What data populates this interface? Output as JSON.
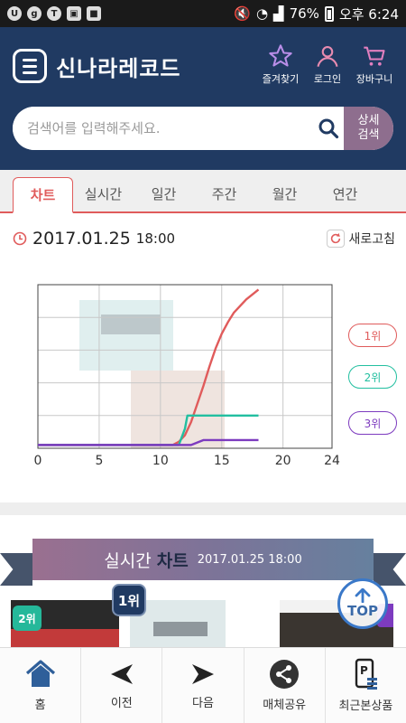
{
  "status_bar": {
    "battery": "76%",
    "time": "오후 6:24",
    "left_icons": [
      "circle-u-icon",
      "circle-g-icon",
      "talk-icon",
      "image-icon",
      "app-icon"
    ]
  },
  "header": {
    "logo_text": "신나라레코드",
    "favorites_label": "즐겨찾기",
    "login_label": "로그인",
    "cart_label": "장바구니"
  },
  "search": {
    "placeholder": "검색어를 입력해주세요.",
    "advanced_label_1": "상세",
    "advanced_label_2": "검색"
  },
  "tabs": [
    "차트",
    "실시간",
    "일간",
    "주간",
    "월간",
    "연간"
  ],
  "active_tab": 0,
  "chart_header": {
    "date": "2017.01.25",
    "time": "18:00",
    "refresh_label": "새로고침"
  },
  "chart_data": {
    "type": "line",
    "xlim": [
      0,
      24
    ],
    "x_ticks": [
      "0",
      "5",
      "10",
      "15",
      "20",
      "24"
    ],
    "series": [
      {
        "name": "1위",
        "color": "#e05b5b",
        "x": [
          0,
          11,
          11.5,
          12,
          12.5,
          13,
          13.5,
          14,
          14.5,
          15,
          15.5,
          16,
          17,
          18
        ],
        "y": [
          0.02,
          0.02,
          0.04,
          0.08,
          0.16,
          0.27,
          0.38,
          0.5,
          0.61,
          0.7,
          0.77,
          0.83,
          0.91,
          0.97
        ]
      },
      {
        "name": "2위",
        "color": "#22bfa0",
        "x": [
          0,
          11.5,
          12,
          12.2,
          18
        ],
        "y": [
          0.02,
          0.02,
          0.12,
          0.2,
          0.2
        ]
      },
      {
        "name": "3위",
        "color": "#7d3bbf",
        "x": [
          0,
          12.5,
          13.5,
          18
        ],
        "y": [
          0.02,
          0.02,
          0.05,
          0.05
        ]
      }
    ],
    "grid": true,
    "legend_position": "right"
  },
  "realtime_banner": {
    "label": "실시간",
    "label_bold": "차트",
    "datetime": "2017.01.25 18:00"
  },
  "cards": [
    {
      "rank_label": "2위"
    },
    {
      "rank_label": "1위"
    }
  ],
  "top_button": "TOP",
  "bottom_nav": [
    {
      "label": "홈",
      "icon": "home-icon"
    },
    {
      "label": "이전",
      "icon": "back-arrow-icon"
    },
    {
      "label": "다음",
      "icon": "forward-arrow-icon"
    },
    {
      "label": "매체공유",
      "icon": "share-icon"
    },
    {
      "label": "최근본상품",
      "icon": "recent-items-icon"
    }
  ],
  "colors": {
    "header_bg": "#203a62",
    "accent_red": "#e05b5b",
    "advanced_search_bg": "#8e6e8e"
  }
}
